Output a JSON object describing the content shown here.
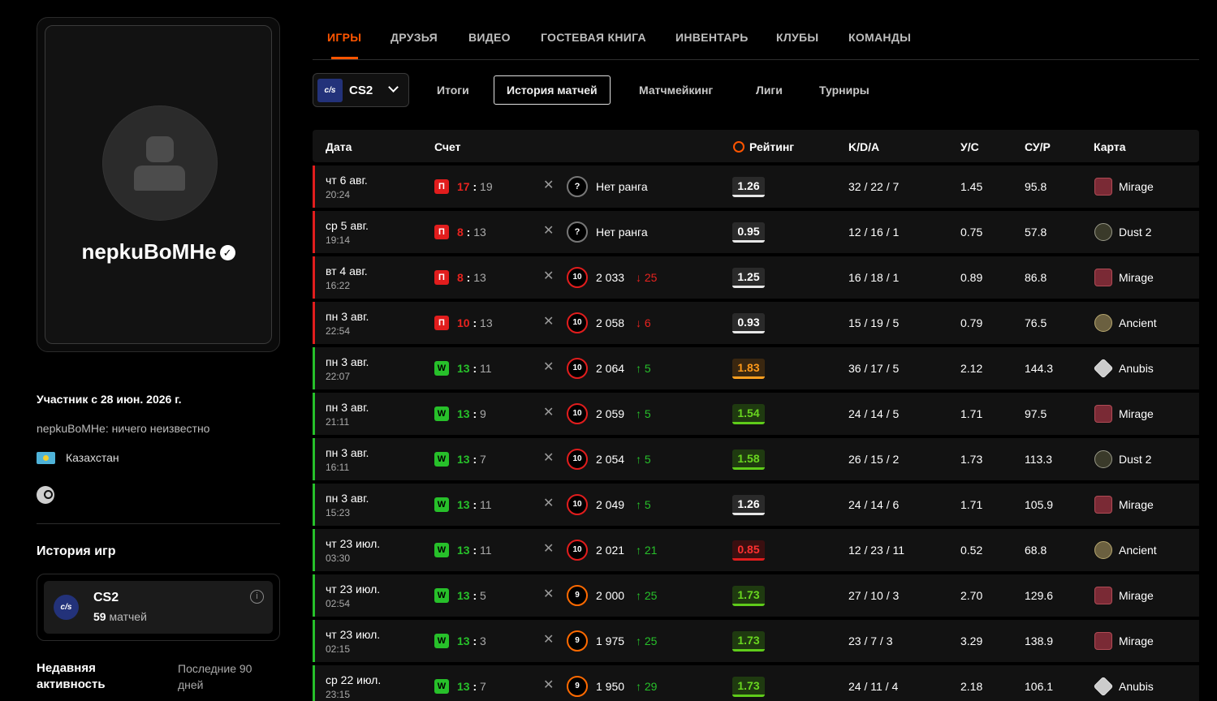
{
  "profile": {
    "nickname": "nepkuBoMHe",
    "verified_icon": "✓",
    "member_since": "Участник с 28 июн. 2026 г.",
    "bio": "nepkuBoMHe: ничего неизвестно",
    "country": "Казахстан",
    "games_title": "История игр",
    "game": {
      "logo": "c/s",
      "name": "CS2",
      "matches_count": "59",
      "matches_label": " матчей",
      "info_icon": "i"
    },
    "activity_title": "Недавняя активность",
    "activity_period": "Последние 90 дней"
  },
  "nav": {
    "tabs": [
      "ИГРЫ",
      "ДРУЗЬЯ",
      "ВИДЕО",
      "ГОСТЕВАЯ КНИГА",
      "ИНВЕНТАРЬ",
      "КЛУБЫ",
      "КОМАНДЫ"
    ],
    "active_tab": "ИГРЫ"
  },
  "subnav": {
    "game_logo": "c/s",
    "game_label": "CS2",
    "tabs": [
      "Итоги",
      "История матчей",
      "Матчмейкинг",
      "Лиги",
      "Турниры"
    ],
    "active": "История матчей"
  },
  "table": {
    "headers": {
      "date": "Дата",
      "score": "Счет",
      "rating": "Рейтинг",
      "kda": "K/D/A",
      "kr": "У/С",
      "adr": "СУ/Р",
      "map": "Карта"
    },
    "rows": [
      {
        "result": "loss",
        "badge": "П",
        "date": "чт 6 авг.",
        "time": "20:24",
        "score_mine": "17",
        "score_theirs": "19",
        "level": "?",
        "elo": "Нет ранга",
        "delta": "",
        "rating": "1.26",
        "rating_color": "neutral",
        "kda": "32 / 22 / 7",
        "kr": "1.45",
        "adr": "95.8",
        "map": "Mirage",
        "map_icon": "mirage"
      },
      {
        "result": "loss",
        "badge": "П",
        "date": "ср 5 авг.",
        "time": "19:14",
        "score_mine": "8",
        "score_theirs": "13",
        "level": "?",
        "elo": "Нет ранга",
        "delta": "",
        "rating": "0.95",
        "rating_color": "neutral",
        "kda": "12 / 16 / 1",
        "kr": "0.75",
        "adr": "57.8",
        "map": "Dust 2",
        "map_icon": "dust"
      },
      {
        "result": "loss",
        "badge": "П",
        "date": "вт 4 авг.",
        "time": "16:22",
        "score_mine": "8",
        "score_theirs": "13",
        "level": "10",
        "elo": "2 033",
        "delta": "↓ 25",
        "rating": "1.25",
        "rating_color": "neutral",
        "kda": "16 / 18 / 1",
        "kr": "0.89",
        "adr": "86.8",
        "map": "Mirage",
        "map_icon": "mirage"
      },
      {
        "result": "loss",
        "badge": "П",
        "date": "пн 3 авг.",
        "time": "22:54",
        "score_mine": "10",
        "score_theirs": "13",
        "level": "10",
        "elo": "2 058",
        "delta": "↓ 6",
        "rating": "0.93",
        "rating_color": "neutral",
        "kda": "15 / 19 / 5",
        "kr": "0.79",
        "adr": "76.5",
        "map": "Ancient",
        "map_icon": "ancient"
      },
      {
        "result": "win",
        "badge": "W",
        "date": "пн 3 авг.",
        "time": "22:07",
        "score_mine": "13",
        "score_theirs": "11",
        "level": "10",
        "elo": "2 064",
        "delta": "↑ 5",
        "rating": "1.83",
        "rating_color": "orange",
        "kda": "36 / 17 / 5",
        "kr": "2.12",
        "adr": "144.3",
        "map": "Anubis",
        "map_icon": "anubis"
      },
      {
        "result": "win",
        "badge": "W",
        "date": "пн 3 авг.",
        "time": "21:11",
        "score_mine": "13",
        "score_theirs": "9",
        "level": "10",
        "elo": "2 059",
        "delta": "↑ 5",
        "rating": "1.54",
        "rating_color": "green",
        "kda": "24 / 14 / 5",
        "kr": "1.71",
        "adr": "97.5",
        "map": "Mirage",
        "map_icon": "mirage"
      },
      {
        "result": "win",
        "badge": "W",
        "date": "пн 3 авг.",
        "time": "16:11",
        "score_mine": "13",
        "score_theirs": "7",
        "level": "10",
        "elo": "2 054",
        "delta": "↑ 5",
        "rating": "1.58",
        "rating_color": "green",
        "kda": "26 / 15 / 2",
        "kr": "1.73",
        "adr": "113.3",
        "map": "Dust 2",
        "map_icon": "dust"
      },
      {
        "result": "win",
        "badge": "W",
        "date": "пн 3 авг.",
        "time": "15:23",
        "score_mine": "13",
        "score_theirs": "11",
        "level": "10",
        "elo": "2 049",
        "delta": "↑ 5",
        "rating": "1.26",
        "rating_color": "neutral",
        "kda": "24 / 14 / 6",
        "kr": "1.71",
        "adr": "105.9",
        "map": "Mirage",
        "map_icon": "mirage"
      },
      {
        "result": "win",
        "badge": "W",
        "date": "чт 23 июл.",
        "time": "03:30",
        "score_mine": "13",
        "score_theirs": "11",
        "level": "10",
        "elo": "2 021",
        "delta": "↑ 21",
        "rating": "0.85",
        "rating_color": "red",
        "kda": "12 / 23 / 11",
        "kr": "0.52",
        "adr": "68.8",
        "map": "Ancient",
        "map_icon": "ancient"
      },
      {
        "result": "win",
        "badge": "W",
        "date": "чт 23 июл.",
        "time": "02:54",
        "score_mine": "13",
        "score_theirs": "5",
        "level": "9",
        "elo": "2 000",
        "delta": "↑ 25",
        "rating": "1.73",
        "rating_color": "green",
        "kda": "27 / 10 / 3",
        "kr": "2.70",
        "adr": "129.6",
        "map": "Mirage",
        "map_icon": "mirage"
      },
      {
        "result": "win",
        "badge": "W",
        "date": "чт 23 июл.",
        "time": "02:15",
        "score_mine": "13",
        "score_theirs": "3",
        "level": "9",
        "elo": "1 975",
        "delta": "↑ 25",
        "rating": "1.73",
        "rating_color": "green",
        "kda": "23 / 7 / 3",
        "kr": "3.29",
        "adr": "138.9",
        "map": "Mirage",
        "map_icon": "mirage"
      },
      {
        "result": "win",
        "badge": "W",
        "date": "ср 22 июл.",
        "time": "23:15",
        "score_mine": "13",
        "score_theirs": "7",
        "level": "9",
        "elo": "1 950",
        "delta": "↑ 29",
        "rating": "1.73",
        "rating_color": "green",
        "kda": "24 / 11 / 4",
        "kr": "2.18",
        "adr": "106.1",
        "map": "Anubis",
        "map_icon": "anubis"
      }
    ]
  },
  "colors": {
    "accent": "#ff5500",
    "win": "#27c02a",
    "loss": "#e11d1d",
    "background": "#000000"
  }
}
